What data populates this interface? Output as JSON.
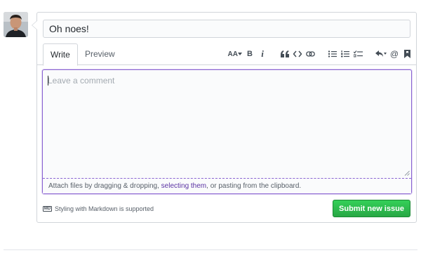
{
  "issue": {
    "title_value": "Oh noes!",
    "tabs": [
      {
        "label": "Write",
        "active": true
      },
      {
        "label": "Preview",
        "active": false
      }
    ],
    "comment": {
      "placeholder": "Leave a comment",
      "value": ""
    },
    "attach": {
      "prefix": "Attach files by dragging & dropping, ",
      "link": "selecting them",
      "suffix": ", or pasting from the clipboard."
    },
    "markdown_badge": "MD",
    "markdown_note": "Styling with Markdown is supported",
    "submit_label": "Submit new issue"
  },
  "toolbar": {
    "items": [
      "text-size-icon",
      "bold-icon",
      "italic-icon",
      "quote-icon",
      "code-icon",
      "link-icon",
      "unordered-list-icon",
      "ordered-list-icon",
      "task-list-icon",
      "reply-icon",
      "mention-icon",
      "bookmark-icon"
    ],
    "heading_label": "AA",
    "bold_label": "B",
    "italic_label": "i",
    "mention_label": "@"
  },
  "colors": {
    "focus_border": "#8a63d2",
    "link": "#5a32a3",
    "submit_green": "#28a745",
    "border": "#d1d5da"
  }
}
